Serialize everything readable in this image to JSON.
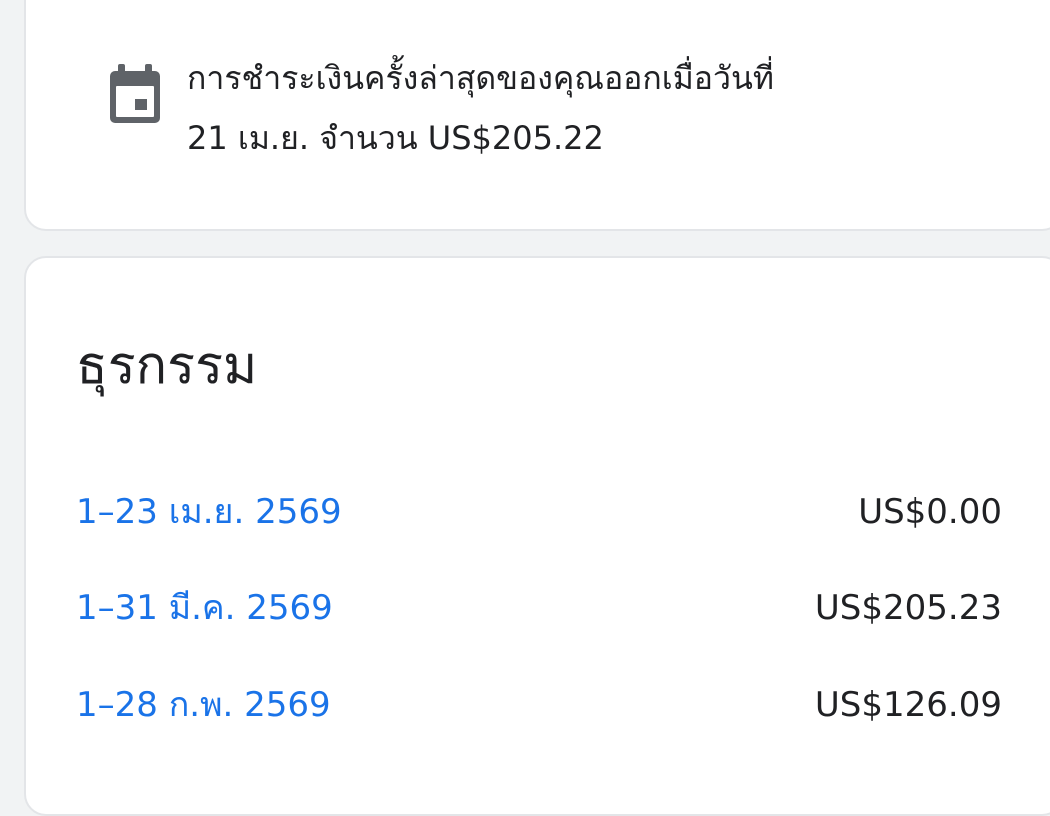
{
  "payment_notice": {
    "icon": "calendar-icon",
    "line1": "การชำระเงินครั้งล่าสุดของคุณออกเมื่อวันที่",
    "line2": "21 เม.ย. จำนวน US$205.22"
  },
  "transactions": {
    "title": "ธุรกรรม",
    "items": [
      {
        "period": "1–23 เม.ย. 2569",
        "amount": "US$0.00"
      },
      {
        "period": "1–31 มี.ค. 2569",
        "amount": "US$205.23"
      },
      {
        "period": "1–28 ก.พ. 2569",
        "amount": "US$126.09"
      }
    ]
  },
  "colors": {
    "link": "#1a73e8",
    "text": "#202124",
    "icon": "#5f6368",
    "background": "#f1f3f4",
    "card": "#ffffff"
  }
}
